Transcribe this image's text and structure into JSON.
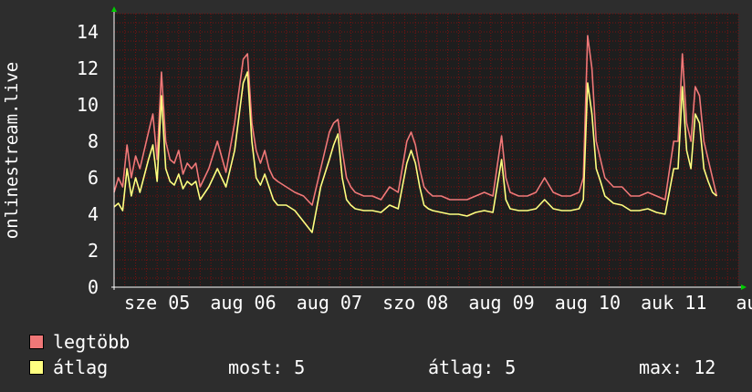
{
  "chart_data": {
    "type": "line",
    "ylabel": "onlinestream.live",
    "ylim": [
      0,
      15
    ],
    "yticks": [
      0,
      2,
      4,
      6,
      8,
      10,
      12,
      14
    ],
    "xlim": [
      0,
      7.25
    ],
    "xticks": [
      {
        "label": "sze 05",
        "x": 0.5
      },
      {
        "label": "aug 06",
        "x": 1.5
      },
      {
        "label": "aug 07",
        "x": 2.5
      },
      {
        "label": "szo 08",
        "x": 3.5
      },
      {
        "label": "aug 09",
        "x": 4.5
      },
      {
        "label": "aug 10",
        "x": 5.5
      },
      {
        "label": "auk 11",
        "x": 6.5
      },
      {
        "label": "au",
        "x": 7.35
      }
    ],
    "grid": true,
    "colors": {
      "max": "#f07878",
      "avg": "#ffff80",
      "grid": "#7a1010",
      "axis": "#ffffff",
      "plot_bg": "#1e1e1e",
      "arrow": "#00cc00"
    },
    "series": [
      {
        "name": "legtöbb",
        "color": "#f07878",
        "x": [
          0,
          0.05,
          0.1,
          0.15,
          0.2,
          0.25,
          0.3,
          0.4,
          0.45,
          0.5,
          0.55,
          0.6,
          0.65,
          0.7,
          0.75,
          0.8,
          0.85,
          0.9,
          0.95,
          1.0,
          1.1,
          1.2,
          1.3,
          1.4,
          1.5,
          1.55,
          1.6,
          1.65,
          1.7,
          1.75,
          1.8,
          1.85,
          1.9,
          2.0,
          2.1,
          2.2,
          2.3,
          2.4,
          2.5,
          2.55,
          2.6,
          2.65,
          2.7,
          2.75,
          2.8,
          2.9,
          3.0,
          3.1,
          3.2,
          3.3,
          3.4,
          3.45,
          3.5,
          3.55,
          3.6,
          3.65,
          3.7,
          3.8,
          3.9,
          4.0,
          4.1,
          4.2,
          4.3,
          4.4,
          4.5,
          4.55,
          4.6,
          4.7,
          4.8,
          4.9,
          5.0,
          5.1,
          5.2,
          5.3,
          5.4,
          5.45,
          5.5,
          5.55,
          5.6,
          5.65,
          5.7,
          5.8,
          5.9,
          6.0,
          6.1,
          6.2,
          6.3,
          6.4,
          6.5,
          6.55,
          6.6,
          6.65,
          6.7,
          6.75,
          6.8,
          6.85,
          6.9,
          6.95,
          7.0
        ],
        "y": [
          5.2,
          6.0,
          5.5,
          7.8,
          6.0,
          7.2,
          6.5,
          8.5,
          9.5,
          7.0,
          11.8,
          8.0,
          7.0,
          6.8,
          7.5,
          6.2,
          6.8,
          6.5,
          6.8,
          5.5,
          6.5,
          8.0,
          6.3,
          9.0,
          12.5,
          12.8,
          9.0,
          7.5,
          6.8,
          7.5,
          6.5,
          6.0,
          5.8,
          5.5,
          5.2,
          5.0,
          4.5,
          6.5,
          8.5,
          9.0,
          9.2,
          7.5,
          6.0,
          5.5,
          5.2,
          5.0,
          5.0,
          4.8,
          5.5,
          5.2,
          8.0,
          8.5,
          7.8,
          6.5,
          5.5,
          5.2,
          5.0,
          5.0,
          4.8,
          4.8,
          4.8,
          5.0,
          5.2,
          5.0,
          8.3,
          6.0,
          5.2,
          5.0,
          5.0,
          5.2,
          6.0,
          5.2,
          5.0,
          5.0,
          5.2,
          6.0,
          13.8,
          12.0,
          8.0,
          7.0,
          6.0,
          5.5,
          5.5,
          5.0,
          5.0,
          5.2,
          5.0,
          4.8,
          8.0,
          8.0,
          12.8,
          9.0,
          8.0,
          11.0,
          10.5,
          8.0,
          7.0,
          6.0,
          5.0
        ]
      },
      {
        "name": "átlag",
        "color": "#ffff80",
        "x": [
          0,
          0.05,
          0.1,
          0.15,
          0.2,
          0.25,
          0.3,
          0.4,
          0.45,
          0.5,
          0.55,
          0.6,
          0.65,
          0.7,
          0.75,
          0.8,
          0.85,
          0.9,
          0.95,
          1.0,
          1.1,
          1.2,
          1.3,
          1.4,
          1.5,
          1.55,
          1.6,
          1.65,
          1.7,
          1.75,
          1.8,
          1.85,
          1.9,
          2.0,
          2.1,
          2.2,
          2.3,
          2.4,
          2.5,
          2.55,
          2.6,
          2.65,
          2.7,
          2.75,
          2.8,
          2.9,
          3.0,
          3.1,
          3.2,
          3.3,
          3.4,
          3.45,
          3.5,
          3.55,
          3.6,
          3.65,
          3.7,
          3.8,
          3.9,
          4.0,
          4.1,
          4.2,
          4.3,
          4.4,
          4.5,
          4.55,
          4.6,
          4.7,
          4.8,
          4.9,
          5.0,
          5.1,
          5.2,
          5.3,
          5.4,
          5.45,
          5.5,
          5.55,
          5.6,
          5.65,
          5.7,
          5.8,
          5.9,
          6.0,
          6.1,
          6.2,
          6.3,
          6.4,
          6.5,
          6.55,
          6.6,
          6.65,
          6.7,
          6.75,
          6.8,
          6.85,
          6.9,
          6.95,
          7.0
        ],
        "y": [
          4.4,
          4.6,
          4.2,
          6.5,
          5.0,
          6.0,
          5.2,
          7.0,
          7.8,
          5.8,
          10.5,
          6.5,
          5.8,
          5.6,
          6.2,
          5.4,
          5.8,
          5.6,
          5.8,
          4.8,
          5.5,
          6.5,
          5.5,
          7.5,
          11.2,
          11.8,
          8.0,
          6.0,
          5.6,
          6.2,
          5.5,
          4.8,
          4.5,
          4.5,
          4.2,
          3.6,
          3.0,
          5.5,
          7.0,
          7.8,
          8.4,
          6.0,
          4.8,
          4.5,
          4.3,
          4.2,
          4.2,
          4.1,
          4.5,
          4.3,
          6.8,
          7.5,
          6.8,
          5.5,
          4.5,
          4.3,
          4.2,
          4.1,
          4.0,
          4.0,
          3.9,
          4.1,
          4.2,
          4.1,
          7.0,
          4.8,
          4.3,
          4.2,
          4.2,
          4.3,
          4.8,
          4.3,
          4.2,
          4.2,
          4.3,
          4.8,
          11.2,
          9.5,
          6.5,
          5.8,
          5.0,
          4.6,
          4.5,
          4.2,
          4.2,
          4.3,
          4.1,
          4.0,
          6.5,
          6.5,
          11.0,
          7.5,
          6.5,
          9.5,
          9.0,
          6.5,
          5.8,
          5.2,
          5.0
        ]
      }
    ]
  },
  "legend": {
    "items": [
      {
        "label": "legtöbb",
        "color": "#f07878"
      },
      {
        "label": "átlag",
        "color": "#ffff80"
      }
    ],
    "most": "most: 5",
    "atlag": "átlag: 5",
    "max": "max: 12"
  }
}
